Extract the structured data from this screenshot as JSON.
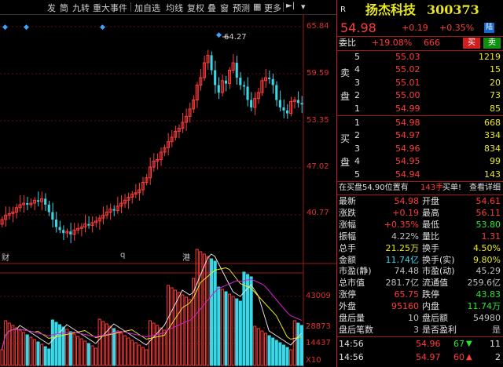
{
  "toolbar": {
    "items": [
      "发",
      "筒",
      "九转",
      "重大事件",
      "加自选",
      "均线",
      "复权",
      "叠",
      "窗",
      "预测",
      "更多"
    ]
  },
  "chart": {
    "price_ticks": [
      "65.84",
      "59.59",
      "53.35",
      "47.02",
      "40.77"
    ],
    "volume_ticks": [
      "43009",
      "28873",
      "14437",
      "X10"
    ],
    "marks": [
      "财",
      "q",
      "港"
    ],
    "peak_label": "64.27"
  },
  "quote": {
    "r_badge": "R",
    "name": "扬杰科技",
    "code": "300373",
    "price": "54.98",
    "change": "+0.19",
    "change_pct": "+0.35%",
    "lu": "陆",
    "weibi_label": "委比",
    "weibi_value": "+19.08%",
    "weibi_diff": "666",
    "buy_btn": "买",
    "sell_btn": "卖",
    "sell_label": [
      "卖",
      "盘"
    ],
    "buy_label": [
      "买",
      "盘"
    ],
    "asks": [
      {
        "level": "5",
        "price": "55.03",
        "vol": "1219"
      },
      {
        "level": "4",
        "price": "55.02",
        "vol": "15"
      },
      {
        "level": "3",
        "price": "55.01",
        "vol": "20"
      },
      {
        "level": "2",
        "price": "55.00",
        "vol": "73"
      },
      {
        "level": "1",
        "price": "54.99",
        "vol": "85"
      }
    ],
    "bids": [
      {
        "level": "1",
        "price": "54.98",
        "vol": "668"
      },
      {
        "level": "2",
        "price": "54.97",
        "vol": "334"
      },
      {
        "level": "3",
        "price": "54.96",
        "vol": "834"
      },
      {
        "level": "4",
        "price": "54.95",
        "vol": "99"
      },
      {
        "level": "5",
        "price": "54.94",
        "vol": "143"
      }
    ],
    "notice_prefix": "在买盘54.90位置有",
    "notice_amount": "143手",
    "notice_suffix": "买单!",
    "notice_link": "查看详细",
    "stats": [
      {
        "l1": "最新",
        "v1": "54.98",
        "c1": "red",
        "l2": "开盘",
        "v2": "54.61",
        "c2": "red"
      },
      {
        "l1": "涨跌",
        "v1": "+0.19",
        "c1": "red",
        "l2": "最高",
        "v2": "56.11",
        "c2": "red"
      },
      {
        "l1": "涨幅",
        "v1": "+0.35%",
        "c1": "red",
        "l2": "最低",
        "v2": "53.80",
        "c2": "green"
      },
      {
        "l1": "振幅",
        "v1": "4.22%",
        "c1": "grey",
        "l2": "量比",
        "v2": "1.31",
        "c2": "red"
      },
      {
        "l1": "总手",
        "v1": "21.25万",
        "c1": "yellow",
        "l2": "换手",
        "v2": "4.50%",
        "c2": "yellow"
      },
      {
        "l1": "金额",
        "v1": "11.74亿",
        "c1": "cyan",
        "l2": "换手(实)",
        "v2": "9.80%",
        "c2": "yellow"
      },
      {
        "l1": "市盈(静)",
        "v1": "74.48",
        "c1": "grey",
        "l2": "市盈(动)",
        "v2": "45.29",
        "c2": "grey"
      },
      {
        "l1": "总市值",
        "v1": "281.7亿",
        "c1": "grey",
        "l2": "流通值",
        "v2": "259.6亿",
        "c2": "grey"
      },
      {
        "l1": "涨停",
        "v1": "65.75",
        "c1": "red",
        "l2": "跌停",
        "v2": "43.83",
        "c2": "green"
      },
      {
        "l1": "外盘",
        "v1": "95160",
        "c1": "red",
        "l2": "内盘",
        "v2": "11.74万",
        "c2": "green"
      },
      {
        "l1": "盘后量",
        "v1": "10",
        "c1": "grey",
        "l2": "盘后额",
        "v2": "54980",
        "c2": "grey"
      },
      {
        "l1": "盘后笔数",
        "v1": "3",
        "c1": "grey",
        "l2": "是否盈利",
        "v2": "是",
        "c2": "grey"
      }
    ],
    "ticks": [
      {
        "time": "14:56",
        "price": "54.96",
        "vol": "67",
        "dir": "down",
        "count": "11"
      },
      {
        "time": "14:56",
        "price": "54.97",
        "vol": "60",
        "dir": "up",
        "count": "2"
      }
    ]
  },
  "colors": {
    "up": "#ff3b3b",
    "down": "#2ee62e",
    "bg": "#000000",
    "accent": "#38d8e8"
  }
}
